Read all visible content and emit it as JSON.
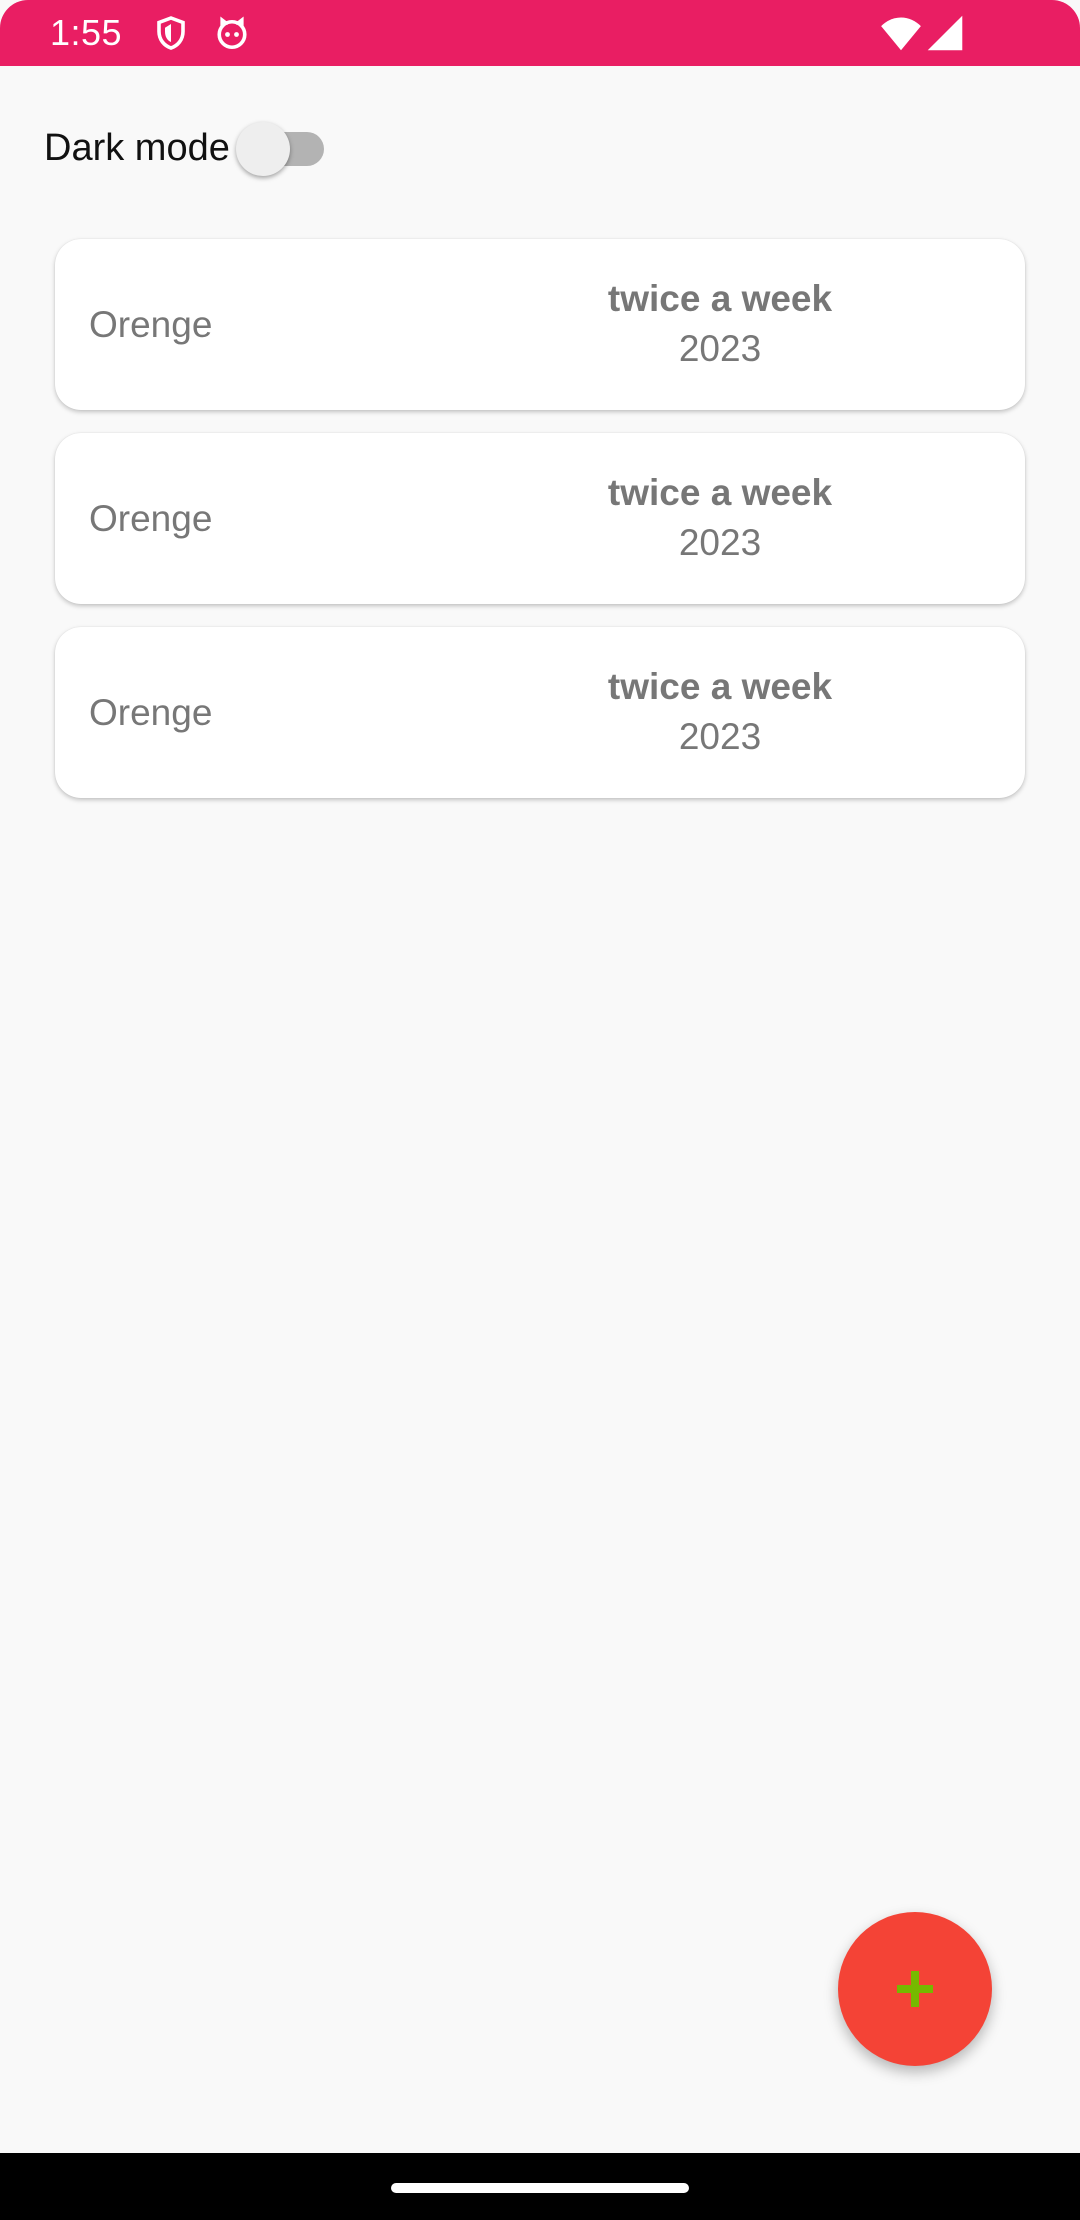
{
  "status_bar": {
    "time": "1:55",
    "icons": [
      "shield-icon",
      "cat-icon",
      "wifi-icon",
      "cellular-signal-icon"
    ],
    "background_color": "#e91e63"
  },
  "settings": {
    "dark_mode_label": "Dark mode",
    "dark_mode_enabled": false
  },
  "cards": [
    {
      "name": "Orenge",
      "frequency": "twice a week",
      "year": "2023"
    },
    {
      "name": "Orenge",
      "frequency": "twice a week",
      "year": "2023"
    },
    {
      "name": "Orenge",
      "frequency": "twice a week",
      "year": "2023"
    }
  ],
  "fab": {
    "icon": "plus-icon",
    "background_color": "#f44336",
    "icon_color": "#76b900"
  }
}
